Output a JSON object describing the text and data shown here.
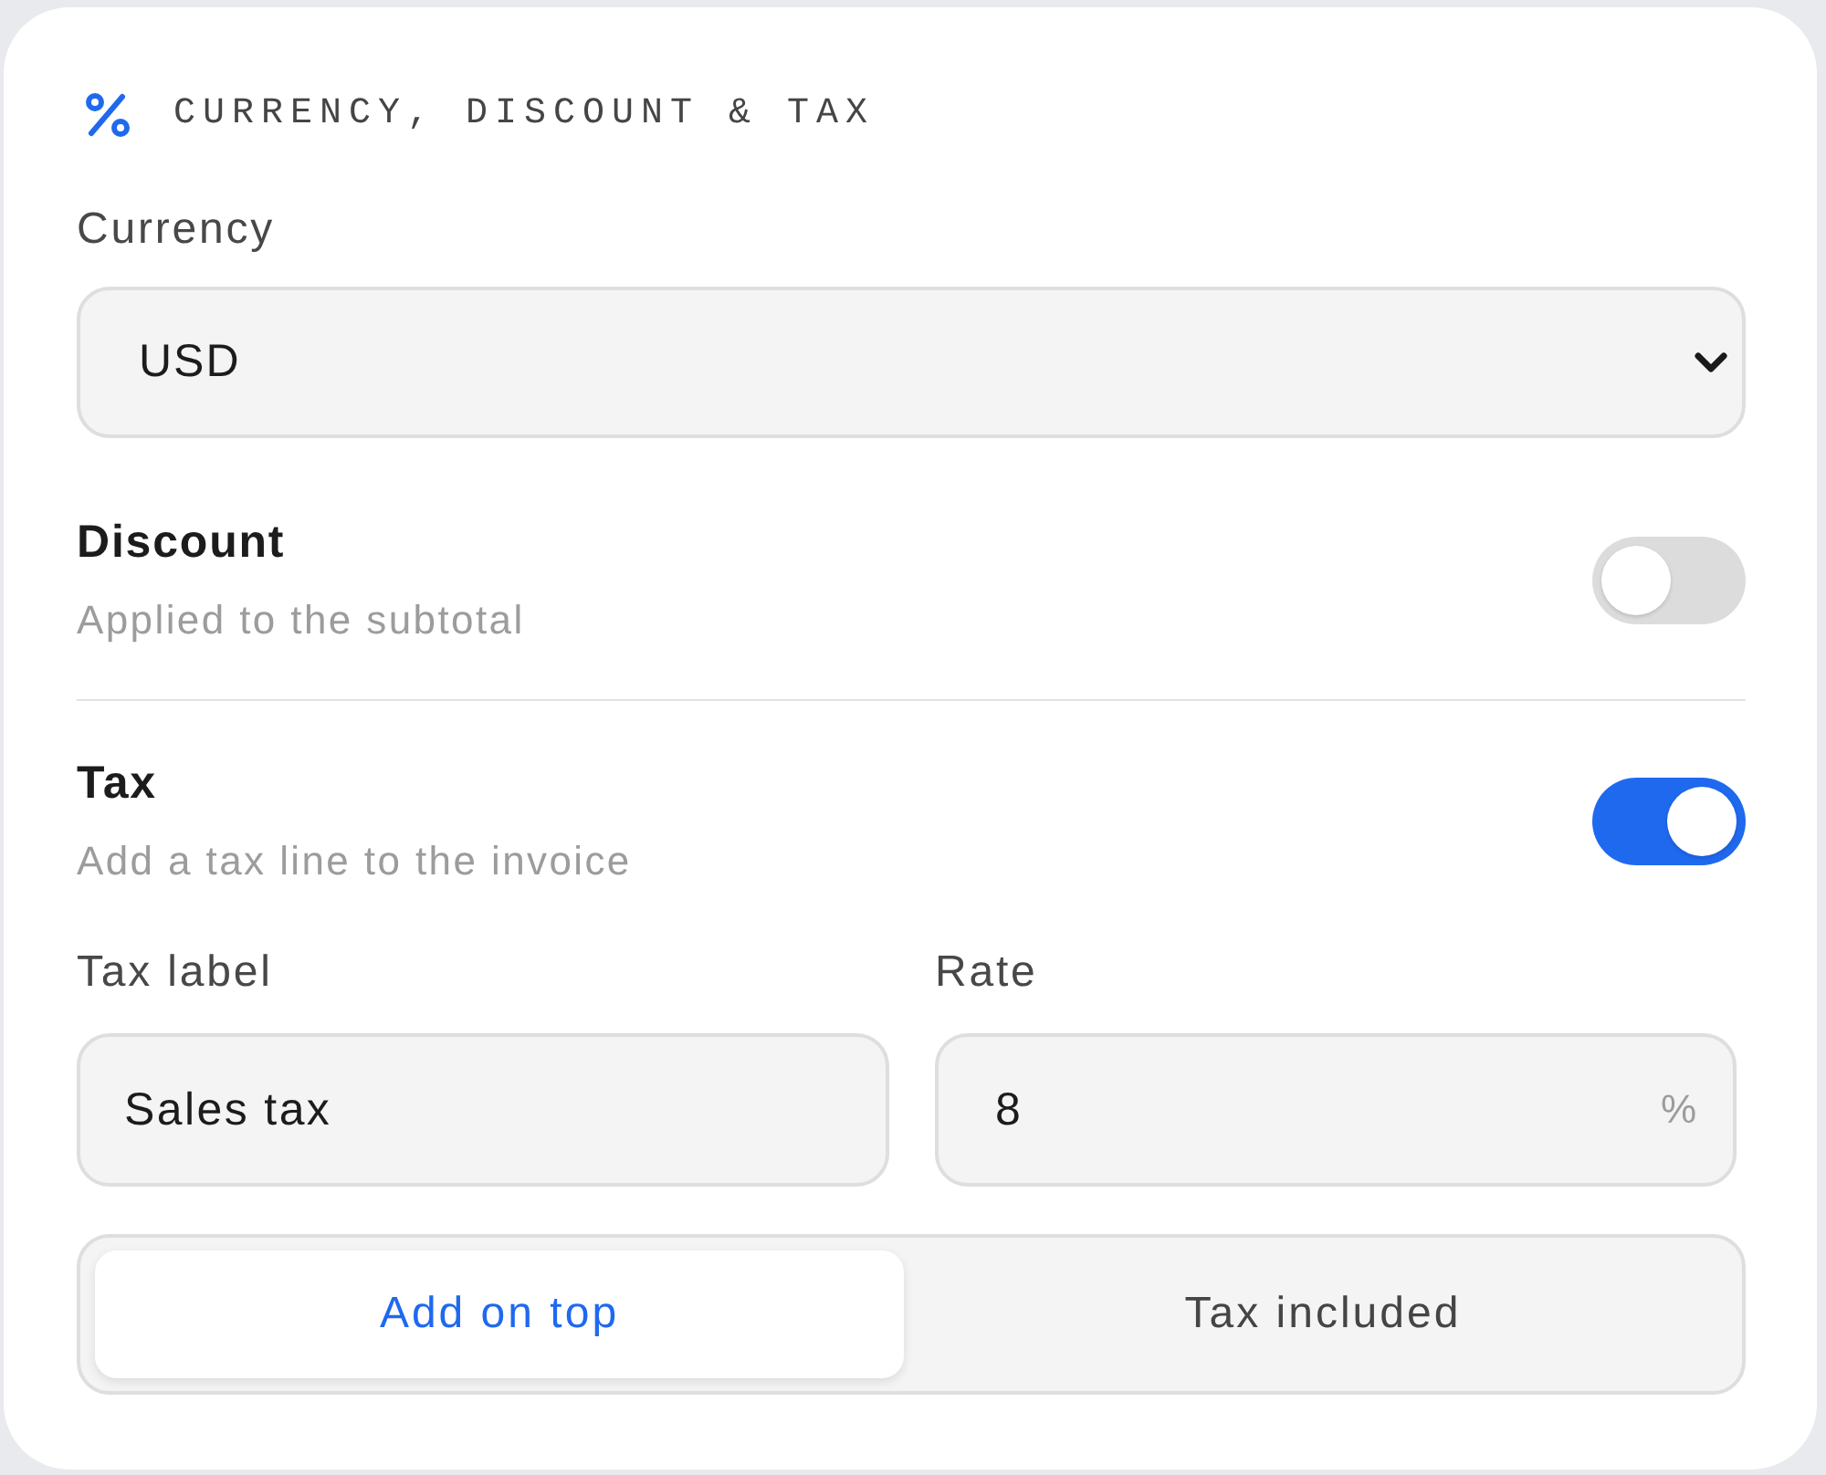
{
  "section": {
    "title": "CURRENCY, DISCOUNT & TAX"
  },
  "currency": {
    "label": "Currency",
    "value": "USD"
  },
  "toggles": [
    {
      "title": "Discount",
      "description": "Applied to the subtotal",
      "on": false
    },
    {
      "title": "Tax",
      "description": "Add a tax line to the invoice",
      "on": true
    }
  ],
  "tax_fields": [
    {
      "label": "Tax label",
      "value": "Sales tax"
    },
    {
      "label": "Rate",
      "value": "8",
      "suffix": "%"
    }
  ],
  "tax_mode": [
    {
      "label": "Add on top",
      "selected": true
    },
    {
      "label": "Tax included",
      "selected": false
    }
  ]
}
